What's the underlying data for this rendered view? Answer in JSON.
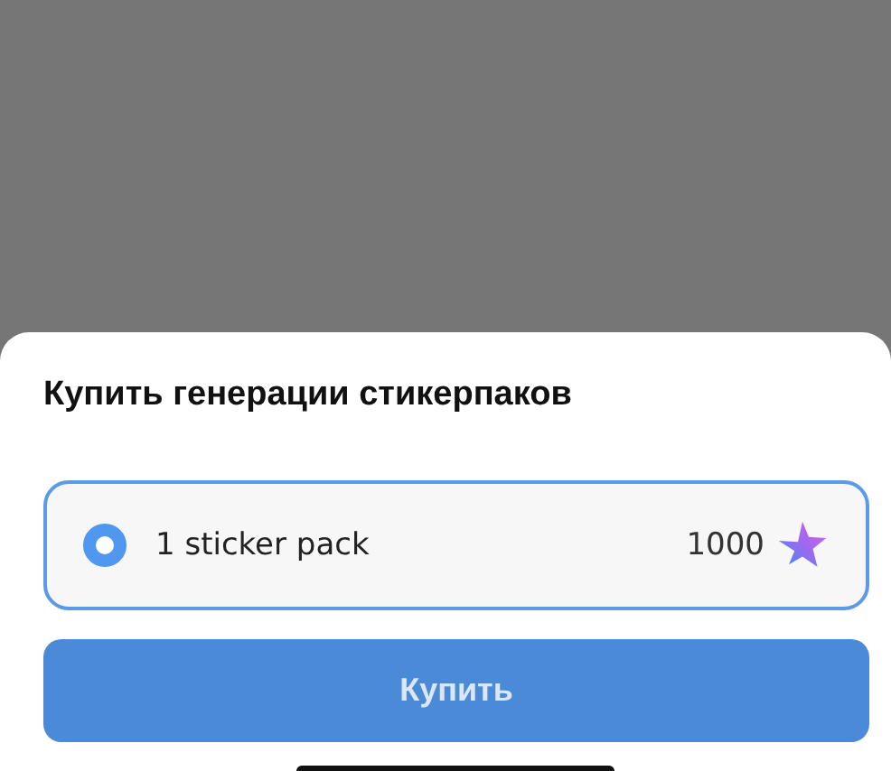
{
  "sheet": {
    "title": "Купить генерации стикерпаков"
  },
  "options": [
    {
      "label": "1 sticker pack",
      "price": "1000",
      "selected": true
    }
  ],
  "buy_button": {
    "label": "Купить"
  }
}
